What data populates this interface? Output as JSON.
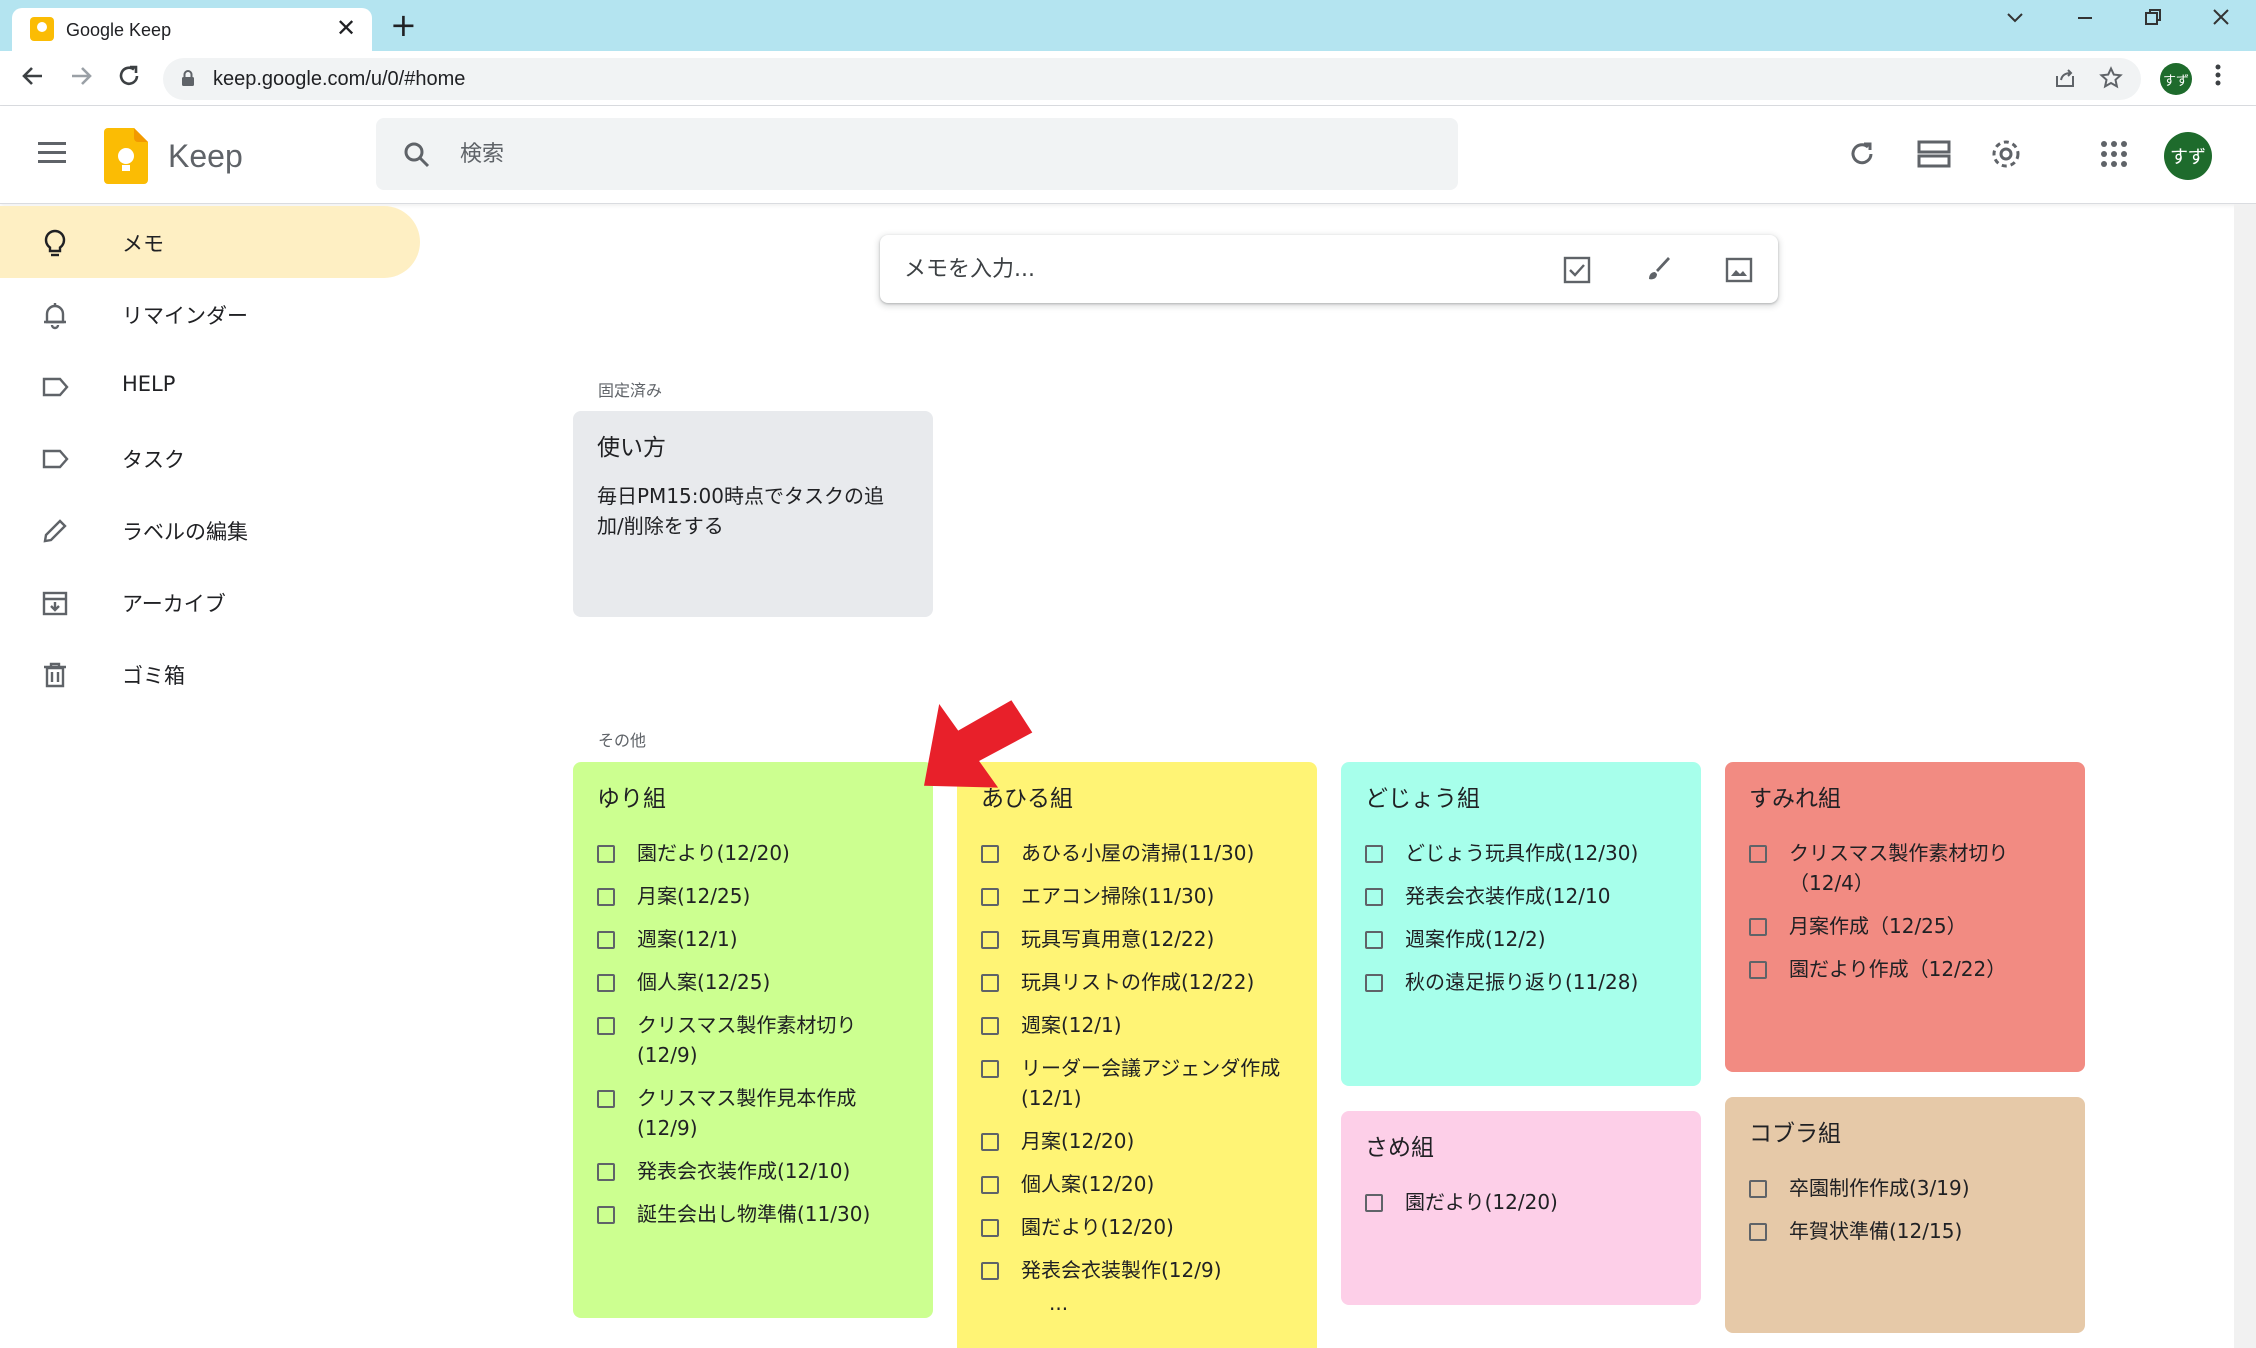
{
  "browser": {
    "tab_title": "Google Keep",
    "url": "keep.google.com/u/0/#home",
    "profile_initials": "すず"
  },
  "header": {
    "app_name": "Keep",
    "search_placeholder": "検索",
    "user_initials": "すず"
  },
  "sidebar": {
    "items": [
      {
        "label": "メモ",
        "icon": "lightbulb-icon",
        "active": true
      },
      {
        "label": "リマインダー",
        "icon": "bell-icon"
      },
      {
        "label": "HELP",
        "icon": "label-icon"
      },
      {
        "label": "タスク",
        "icon": "label-icon"
      },
      {
        "label": "ラベルの編集",
        "icon": "pencil-icon"
      },
      {
        "label": "アーカイブ",
        "icon": "archive-icon"
      },
      {
        "label": "ゴミ箱",
        "icon": "trash-icon"
      }
    ]
  },
  "take_note": {
    "placeholder": "メモを入力..."
  },
  "sections": {
    "pinned": "固定済み",
    "others": "その他"
  },
  "notes": {
    "pinned": {
      "title": "使い方",
      "text": "毎日PM15:00時点でタスクの追加/削除をする",
      "color": "#e8eaed"
    },
    "yuri": {
      "title": "ゆり組",
      "color": "#ccff90",
      "items": [
        "園だより(12/20)",
        "月案(12/25)",
        "週案(12/1)",
        "個人案(12/25)",
        "クリスマス製作素材切り(12/9)",
        "クリスマス製作見本作成(12/9)",
        "発表会衣装作成(12/10)",
        "誕生会出し物準備(11/30)"
      ]
    },
    "ahiru": {
      "title": "あひる組",
      "color": "#fff475",
      "items": [
        "あひる小屋の清掃(11/30)",
        "エアコン掃除(11/30)",
        "玩具写真用意(12/22)",
        "玩具リストの作成(12/22)",
        "週案(12/1)",
        "リーダー会議アジェンダ作成(12/1)",
        "月案(12/20)",
        "個人案(12/20)",
        "園だより(12/20)",
        "発表会衣装製作(12/9)"
      ],
      "more": "..."
    },
    "dojou": {
      "title": "どじょう組",
      "color": "#a7ffeb",
      "items": [
        "どじょう玩具作成(12/30)",
        "発表会衣装作成(12/10",
        "週案作成(12/2)",
        "秋の遠足振り返り(11/28)"
      ]
    },
    "same": {
      "title": "さめ組",
      "color": "#fdcfe8",
      "items": [
        "園だより(12/20)"
      ]
    },
    "sumire": {
      "title": "すみれ組",
      "color": "#f28b82",
      "items": [
        "クリスマス製作素材切り（12/4）",
        "月案作成（12/25）",
        "園だより作成（12/22）"
      ]
    },
    "kobura": {
      "title": "コブラ組",
      "color": "#e6c9a8",
      "items": [
        "卒園制作作成(3/19)",
        "年賀状準備(12/15)"
      ]
    }
  },
  "annotation_color": "#e8202a"
}
